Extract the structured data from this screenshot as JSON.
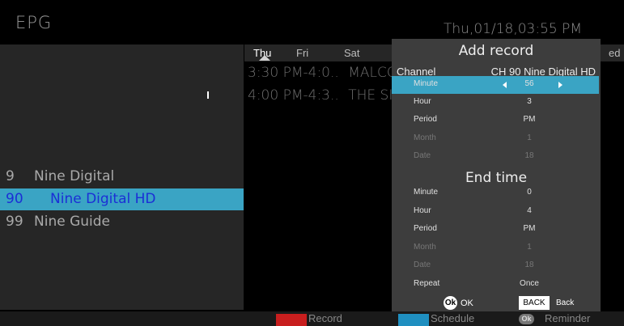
{
  "header": {
    "title": "EPG",
    "datetime": "Thu,01/18,03:55 PM"
  },
  "days": [
    "Thu",
    "Fri",
    "Sat",
    "ed"
  ],
  "programs": [
    {
      "time": "3:30 PM-4:0..",
      "name": "MALCO"
    },
    {
      "time": "4:00 PM-4:3..",
      "name": "THE SI"
    }
  ],
  "channels": [
    {
      "number": "9",
      "name": "Nine Digital",
      "selected": false
    },
    {
      "number": "90",
      "name": "Nine Digital HD",
      "selected": true
    },
    {
      "number": "99",
      "name": "Nine Guide",
      "selected": false
    }
  ],
  "dialog": {
    "title": "Add record",
    "channel_label": "Channel",
    "channel_value": "CH 90  Nine Digital HD",
    "start": [
      {
        "label": "Minute",
        "value": "56",
        "state": "selected"
      },
      {
        "label": "Hour",
        "value": "3",
        "state": "normal"
      },
      {
        "label": "Period",
        "value": "PM",
        "state": "normal"
      },
      {
        "label": "Month",
        "value": "1",
        "state": "dim"
      },
      {
        "label": "Date",
        "value": "18",
        "state": "dim"
      }
    ],
    "end_title": "End time",
    "end": [
      {
        "label": "Minute",
        "value": "0",
        "state": "normal"
      },
      {
        "label": "Hour",
        "value": "4",
        "state": "normal"
      },
      {
        "label": "Period",
        "value": "PM",
        "state": "normal"
      },
      {
        "label": "Month",
        "value": "1",
        "state": "dim"
      },
      {
        "label": "Date",
        "value": "18",
        "state": "dim"
      },
      {
        "label": "Repeat",
        "value": "Once",
        "state": "normal"
      }
    ],
    "ok_badge": "Ok",
    "ok_label": "OK",
    "back_badge": "BACK",
    "back_label": "Back"
  },
  "footer": {
    "record_label": "Record",
    "schedule_label": "Schedule",
    "reminder_badge": "Ok",
    "reminder_label": "Reminder"
  },
  "colors": {
    "accent": "#3aa4c4",
    "record": "#c81e1e",
    "schedule": "#1f8fc0",
    "selected_channel_text": "#1b2fd6"
  }
}
